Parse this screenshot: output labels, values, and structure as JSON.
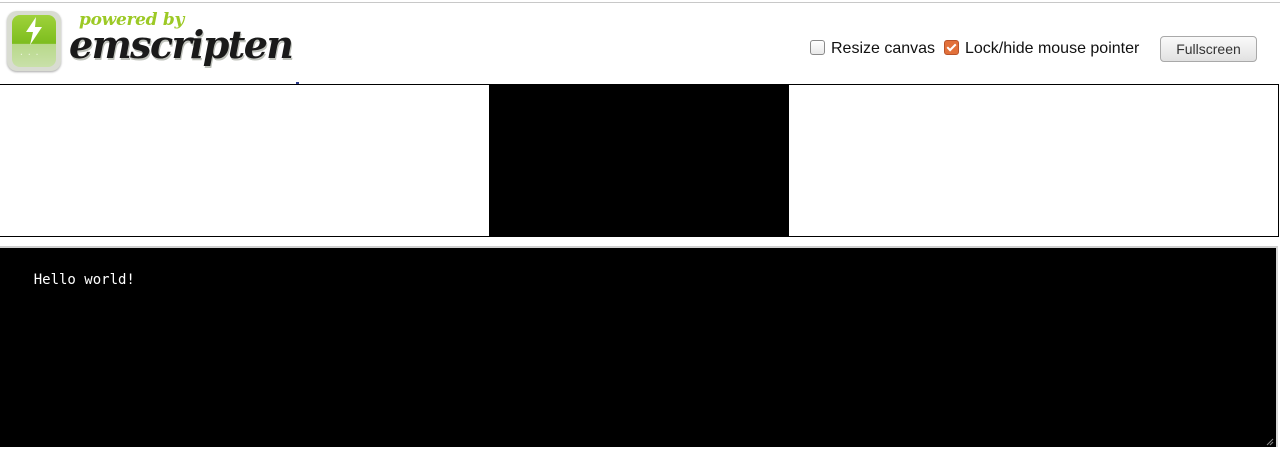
{
  "header": {
    "powered_by": "powered by",
    "brand": "emscripten",
    "logo_icon": "emscripten-logo-icon",
    "brand_color": "#9cc925"
  },
  "controls": {
    "resize_canvas": {
      "label": "Resize canvas",
      "checked": false
    },
    "lock_pointer": {
      "label": "Lock/hide mouse pointer",
      "checked": true,
      "accent": "#e2703a"
    },
    "fullscreen_label": "Fullscreen"
  },
  "output": {
    "text": "Hello world!"
  }
}
